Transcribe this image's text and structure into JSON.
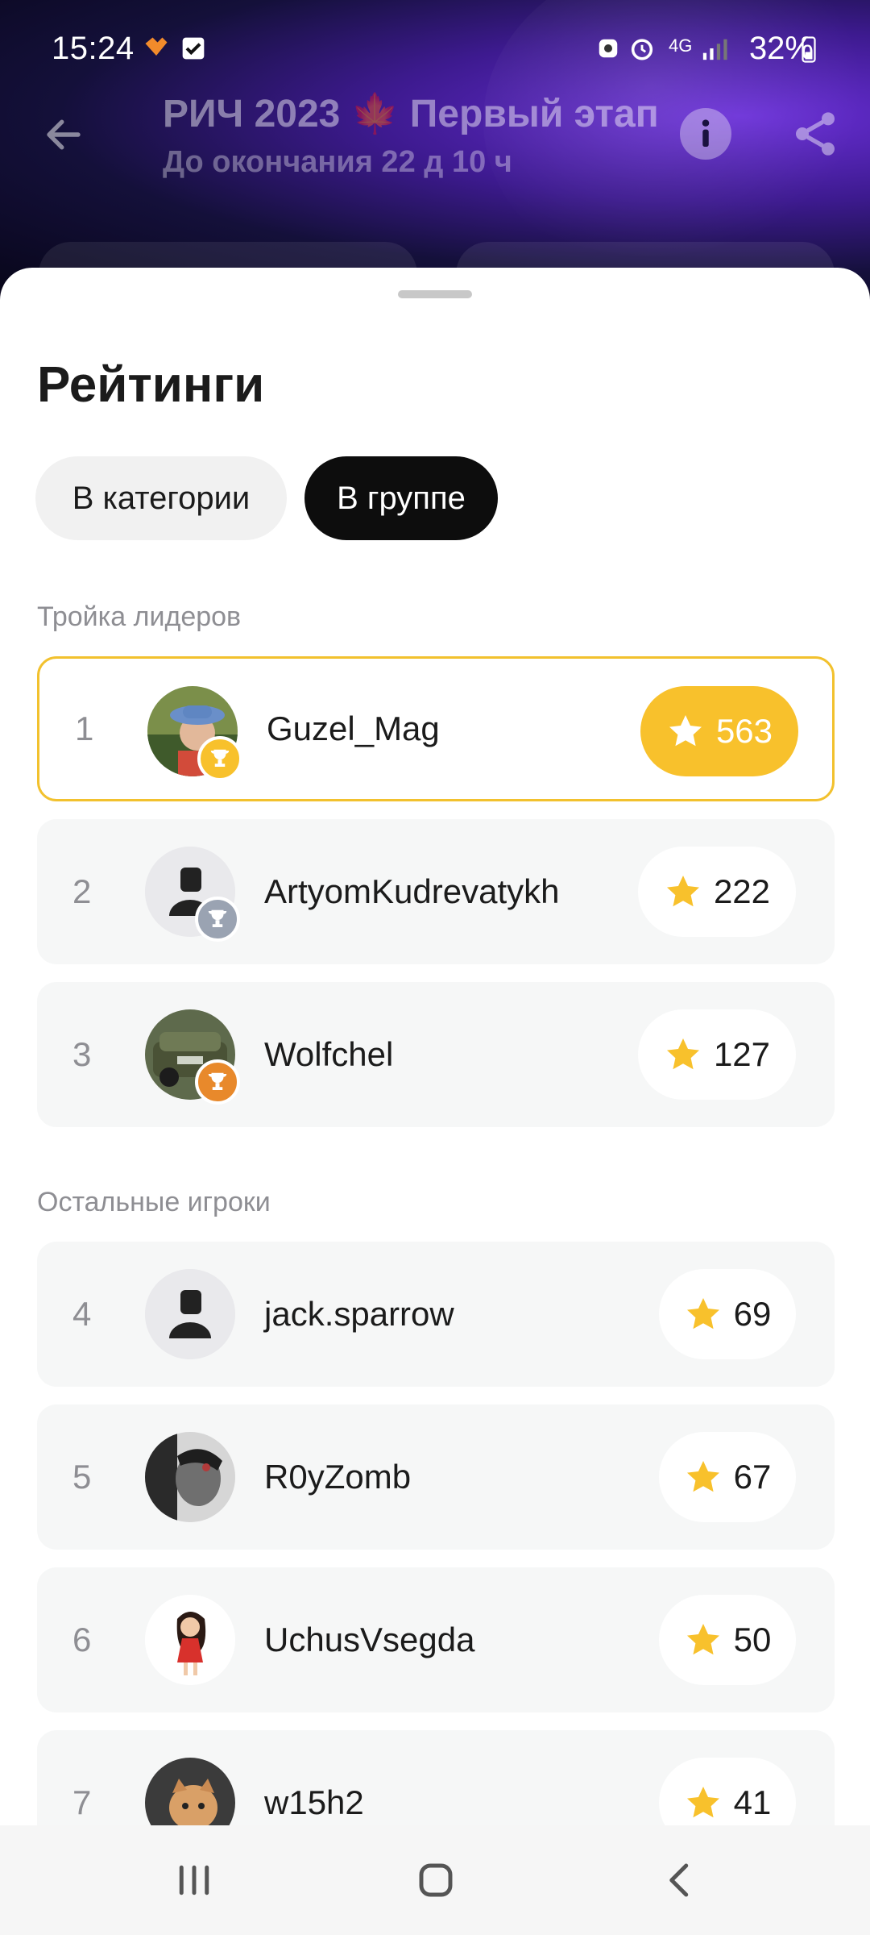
{
  "status": {
    "time": "15:24",
    "battery": "32%",
    "network": "4G"
  },
  "header": {
    "title": "РИЧ 2023 🍁 Первый этап",
    "subtitle": "До окончания 22 д 10 ч"
  },
  "sheet": {
    "title": "Рейтинги",
    "tabs": [
      {
        "label": "В категории",
        "active": false
      },
      {
        "label": "В группе",
        "active": true
      }
    ],
    "leaders_label": "Тройка лидеров",
    "others_label": "Остальные игроки",
    "leaders": [
      {
        "rank": "1",
        "name": "Guzel_Mag",
        "score": "563",
        "trophy": "gold"
      },
      {
        "rank": "2",
        "name": "ArtyomKudrevatykh",
        "score": "222",
        "trophy": "silver"
      },
      {
        "rank": "3",
        "name": "Wolfchel",
        "score": "127",
        "trophy": "bronze"
      }
    ],
    "others": [
      {
        "rank": "4",
        "name": "jack.sparrow",
        "score": "69"
      },
      {
        "rank": "5",
        "name": "R0yZomb",
        "score": "67"
      },
      {
        "rank": "6",
        "name": "UchusVsegda",
        "score": "50"
      },
      {
        "rank": "7",
        "name": "w15h2",
        "score": "41"
      }
    ]
  },
  "colors": {
    "accent_gold": "#f8c12c",
    "silver": "#9aa3b2",
    "bronze": "#e8892b",
    "tab_active": "#0d0d0d"
  },
  "icons": [
    "back-arrow-icon",
    "info-icon",
    "share-icon",
    "star-icon",
    "trophy-icon",
    "nav-recent-icon",
    "nav-home-icon",
    "nav-back-icon"
  ]
}
